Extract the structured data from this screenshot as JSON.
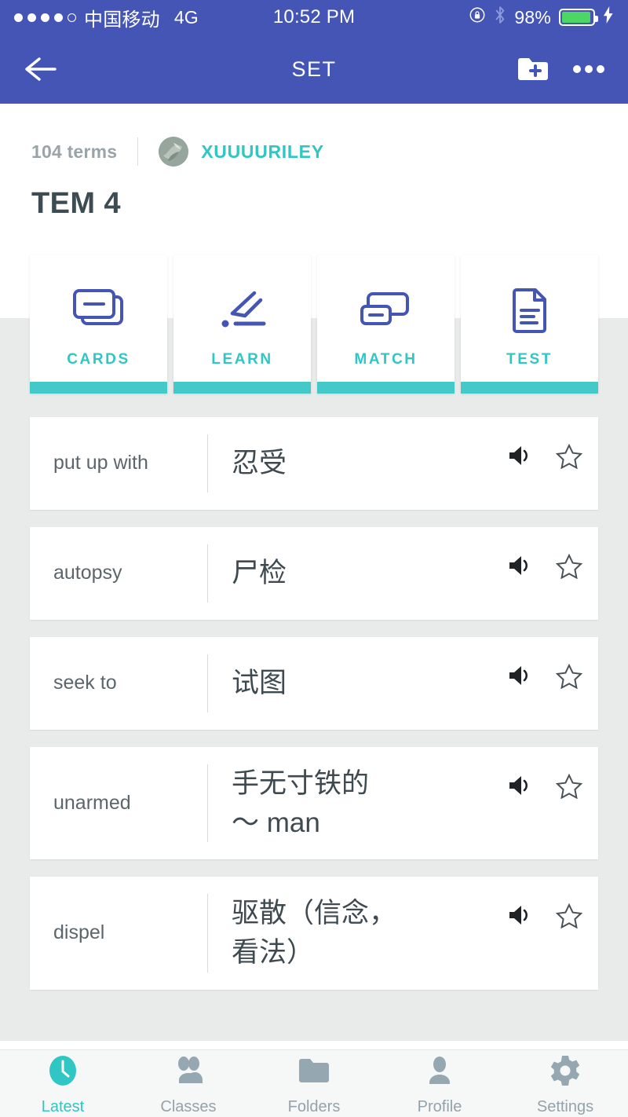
{
  "status_bar": {
    "signal_dots_filled": 4,
    "signal_dots_total": 5,
    "carrier": "中国移动",
    "network": "4G",
    "time": "10:52 PM",
    "battery_percent": "98%",
    "icons": [
      "rotation-lock-icon",
      "bluetooth-icon",
      "battery-icon",
      "charging-bolt-icon"
    ]
  },
  "navbar": {
    "back_label": "back-arrow",
    "title": "SET",
    "add_to_folder_label": "add-to-folder",
    "more_label": "more-options"
  },
  "header": {
    "term_count": "104 terms",
    "username": "XUUUURILEY",
    "set_title": "TEM 4"
  },
  "modes": [
    {
      "label": "CARDS",
      "icon": "cards-icon"
    },
    {
      "label": "LEARN",
      "icon": "pencil-icon"
    },
    {
      "label": "MATCH",
      "icon": "match-icon"
    },
    {
      "label": "TEST",
      "icon": "document-icon"
    }
  ],
  "terms": [
    {
      "term": "put up with",
      "definition": "忍受"
    },
    {
      "term": "autopsy",
      "definition": "尸检"
    },
    {
      "term": "seek to",
      "definition": "试图"
    },
    {
      "term": "unarmed",
      "definition": "手无寸铁的\n～ man"
    },
    {
      "term": "dispel",
      "definition": "驱散（信念，\n看法）"
    }
  ],
  "term_actions": {
    "audio": "speaker-icon",
    "star": "star-outline-icon"
  },
  "tabbar": [
    {
      "label": "Latest",
      "icon": "clock-icon",
      "active": true
    },
    {
      "label": "Classes",
      "icon": "people-icon",
      "active": false
    },
    {
      "label": "Folders",
      "icon": "folder-icon",
      "active": false
    },
    {
      "label": "Profile",
      "icon": "person-icon",
      "active": false
    },
    {
      "label": "Settings",
      "icon": "gear-icon",
      "active": false
    }
  ],
  "colors": {
    "nav_blue": "#4455b6",
    "teal": "#2fc6c4",
    "teal_bar": "#45c8c8",
    "page_grey": "#e9ebeb",
    "icon_blue": "#4455b6",
    "text_dark": "#3f4a50",
    "muted": "#94a3ab"
  }
}
